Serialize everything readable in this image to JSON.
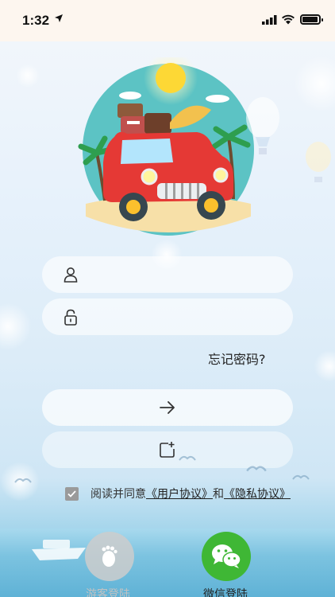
{
  "status_bar": {
    "time": "1:32"
  },
  "login": {
    "username_placeholder": "",
    "password_placeholder": "",
    "forgot_password": "忘记密码?"
  },
  "agreement": {
    "prefix": "阅读并同意",
    "user_agreement": "《用户协议》",
    "conjunction": "和",
    "privacy_policy": "《隐私协议》",
    "checked": true
  },
  "bottom": {
    "guest_login": "游客登陆",
    "wechat_login": "微信登陆"
  },
  "colors": {
    "wechat_green": "#3fb735",
    "field_bg": "#ffffff"
  },
  "icons": [
    "location-arrow-icon",
    "signal-icon",
    "wifi-icon",
    "battery-icon",
    "user-icon",
    "lock-icon",
    "arrow-right-icon",
    "add-document-icon",
    "check-icon",
    "footprint-icon",
    "wechat-icon"
  ]
}
